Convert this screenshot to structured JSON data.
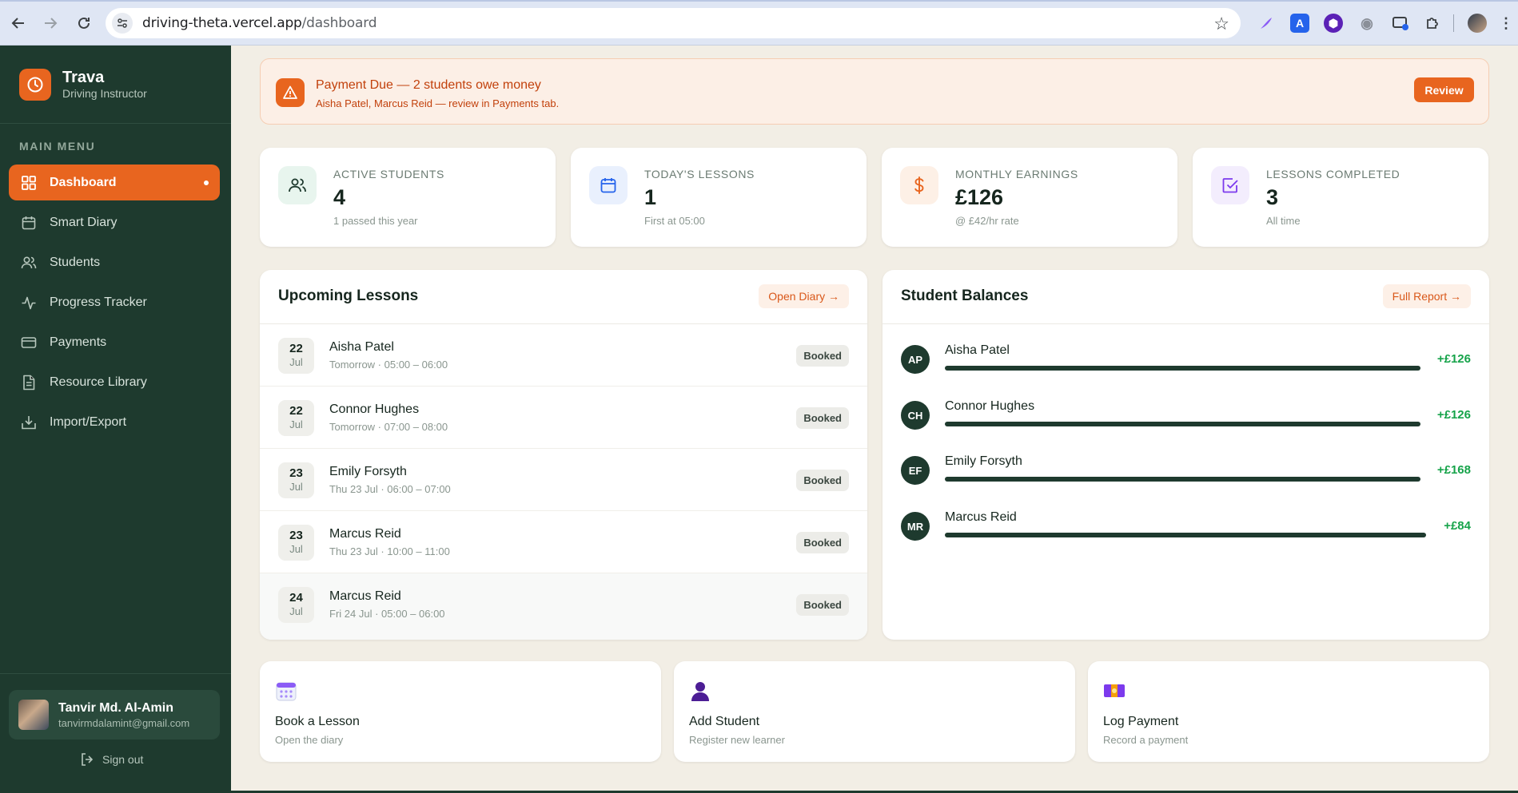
{
  "browser": {
    "url_host": "driving-theta.vercel.app",
    "url_path": "/dashboard"
  },
  "sidebar": {
    "brand_name": "Trava",
    "brand_sub": "Driving Instructor",
    "menu_title": "MAIN MENU",
    "items": [
      {
        "label": "Dashboard",
        "icon": "grid-icon",
        "active": true
      },
      {
        "label": "Smart Diary",
        "icon": "calendar-icon"
      },
      {
        "label": "Students",
        "icon": "users-icon"
      },
      {
        "label": "Progress Tracker",
        "icon": "activity-icon"
      },
      {
        "label": "Payments",
        "icon": "credit-card-icon"
      },
      {
        "label": "Resource Library",
        "icon": "document-icon"
      },
      {
        "label": "Import/Export",
        "icon": "import-export-icon"
      }
    ],
    "user": {
      "name": "Tanvir Md. Al-Amin",
      "email": "tanvirmdalamint@gmail.com"
    },
    "signout_label": "Sign out"
  },
  "banner": {
    "title": "Payment Due — 2 students owe money",
    "subtitle": "Aisha Patel, Marcus Reid — review in Payments tab.",
    "button_label": "Review"
  },
  "stats": [
    {
      "label": "ACTIVE STUDENTS",
      "value": "4",
      "sub": "1 passed this year",
      "icon": "users-icon",
      "accent": "#1e7a4e",
      "tint": "#e8f5ee"
    },
    {
      "label": "TODAY'S LESSONS",
      "value": "1",
      "sub": "First at 05:00",
      "icon": "calendar-icon",
      "accent": "#2563eb",
      "tint": "#e9f0fd"
    },
    {
      "label": "MONTHLY EARNINGS",
      "value": "£126",
      "sub": "@ £42/hr rate",
      "icon": "dollar-icon",
      "accent": "#e8651f",
      "tint": "#fdf0e6"
    },
    {
      "label": "LESSONS COMPLETED",
      "value": "3",
      "sub": "All time",
      "icon": "check-square-icon",
      "accent": "#7c3aed",
      "tint": "#f3edfd"
    }
  ],
  "upcoming": {
    "title": "Upcoming Lessons",
    "link_label": "Open Diary →",
    "lessons": [
      {
        "day": "22",
        "month": "Jul",
        "name": "Aisha Patel",
        "time": "Tomorrow · 05:00 – 06:00",
        "status": "Booked"
      },
      {
        "day": "22",
        "month": "Jul",
        "name": "Connor Hughes",
        "time": "Tomorrow · 07:00 – 08:00",
        "status": "Booked"
      },
      {
        "day": "23",
        "month": "Jul",
        "name": "Emily Forsyth",
        "time": "Thu 23 Jul · 06:00 – 07:00",
        "status": "Booked"
      },
      {
        "day": "23",
        "month": "Jul",
        "name": "Marcus Reid",
        "time": "Thu 23 Jul · 10:00 – 11:00",
        "status": "Booked"
      },
      {
        "day": "24",
        "month": "Jul",
        "name": "Marcus Reid",
        "time": "Fri 24 Jul · 05:00 – 06:00",
        "status": "Booked"
      }
    ]
  },
  "balances": {
    "title": "Student Balances",
    "link_label": "Full Report →",
    "students": [
      {
        "initials": "AP",
        "name": "Aisha Patel",
        "amount": "+£126"
      },
      {
        "initials": "CH",
        "name": "Connor Hughes",
        "amount": "+£126"
      },
      {
        "initials": "EF",
        "name": "Emily Forsyth",
        "amount": "+£168"
      },
      {
        "initials": "MR",
        "name": "Marcus Reid",
        "amount": "+£84"
      }
    ]
  },
  "actions": [
    {
      "title": "Book a Lesson",
      "sub": "Open the diary",
      "icon": "calendar-emoji-icon"
    },
    {
      "title": "Add Student",
      "sub": "Register new learner",
      "icon": "person-silhouette-icon"
    },
    {
      "title": "Log Payment",
      "sub": "Record a payment",
      "icon": "money-icon"
    }
  ]
}
